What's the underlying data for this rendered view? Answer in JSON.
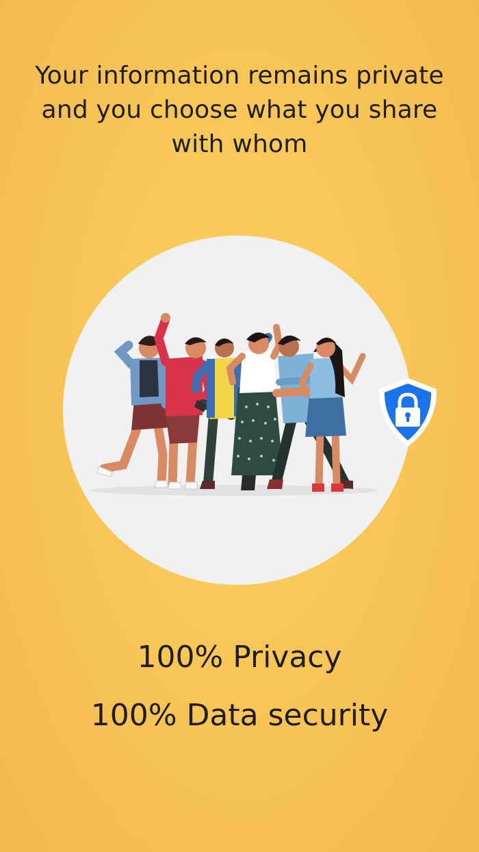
{
  "onboarding": {
    "headline": "Your information remains private and you choose what you share with whom",
    "illustration": {
      "icon": "people-group-illustration",
      "badge_icon": "shield-lock-icon",
      "badge_color": "#1a73e8"
    },
    "stats": {
      "privacy": "100% Privacy",
      "security": "100% Data security"
    },
    "colors": {
      "background": "#f8c657",
      "circle": "#f1f1f1",
      "text": "#1e1e1e"
    }
  }
}
